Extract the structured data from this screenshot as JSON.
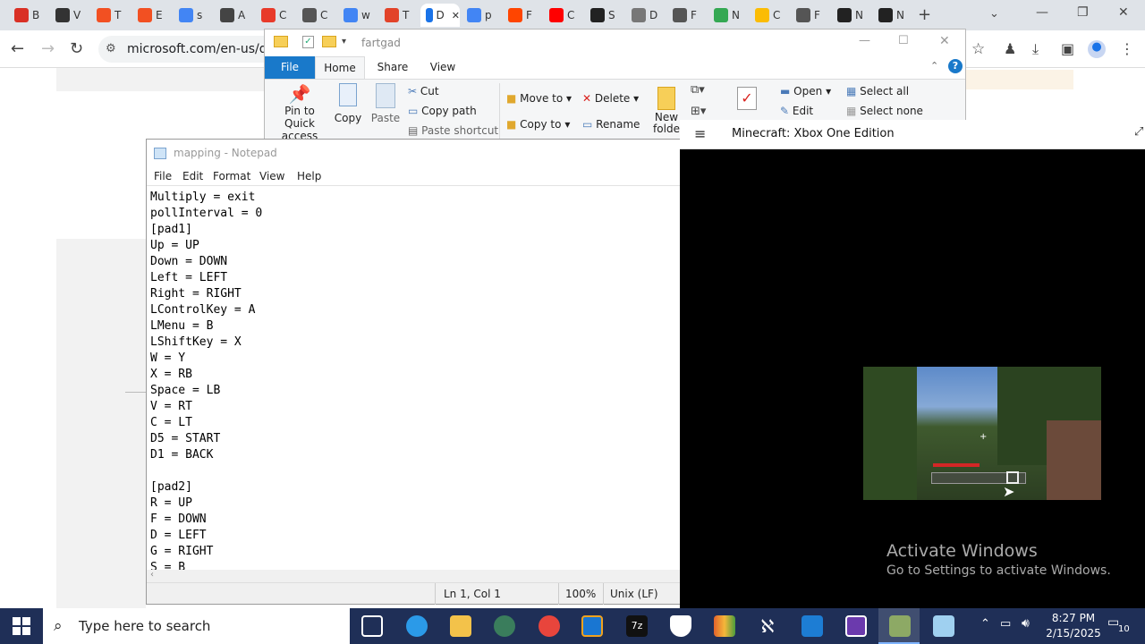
{
  "browser": {
    "tabs": [
      {
        "label": "B",
        "icon": "record-icon",
        "color": "#d93025"
      },
      {
        "label": "V",
        "icon": "book-icon",
        "color": "#333333"
      },
      {
        "label": "T",
        "icon": "windows-logo-icon",
        "color": "#f25022"
      },
      {
        "label": "E",
        "icon": "windows-logo-icon",
        "color": "#f25022"
      },
      {
        "label": "s",
        "icon": "google-icon",
        "color": "#4285f4"
      },
      {
        "label": "A",
        "icon": "tool-icon",
        "color": "#444444"
      },
      {
        "label": "C",
        "icon": "opera-icon",
        "color": "#e83a2a"
      },
      {
        "label": "C",
        "icon": "globe-icon",
        "color": "#555555"
      },
      {
        "label": "w",
        "icon": "google-icon",
        "color": "#4285f4"
      },
      {
        "label": "T",
        "icon": "gitlab-icon",
        "color": "#e24329"
      },
      {
        "label": "D",
        "icon": "page-icon",
        "color": "#1a73e8"
      },
      {
        "label": "p",
        "icon": "google-icon",
        "color": "#4285f4"
      },
      {
        "label": "F",
        "icon": "reddit-icon",
        "color": "#ff4500"
      },
      {
        "label": "C",
        "icon": "youtube-icon",
        "color": "#ff0000"
      },
      {
        "label": "S",
        "icon": "question-icon",
        "color": "#222222"
      },
      {
        "label": "D",
        "icon": "bar-icon",
        "color": "#777777"
      },
      {
        "label": "F",
        "icon": "globe-icon",
        "color": "#555555"
      },
      {
        "label": "N",
        "icon": "drive-icon",
        "color": "#34a853"
      },
      {
        "label": "C",
        "icon": "drive-icon",
        "color": "#fbbc04"
      },
      {
        "label": "F",
        "icon": "globe-icon",
        "color": "#555555"
      },
      {
        "label": "N",
        "icon": "chatgpt-icon",
        "color": "#222222"
      },
      {
        "label": "N",
        "icon": "chatgpt-icon",
        "color": "#222222"
      }
    ],
    "url": "microsoft.com/en-us/dov"
  },
  "explorer": {
    "title": "fartgad",
    "tabs": {
      "file": "File",
      "home": "Home",
      "share": "Share",
      "view": "View"
    },
    "ribbon": {
      "pin": "Pin to Quick access",
      "copy": "Copy",
      "paste": "Paste",
      "cut": "Cut",
      "copy_path": "Copy path",
      "paste_shortcut": "Paste shortcut",
      "move_to": "Move to",
      "copy_to": "Copy to",
      "delete": "Delete",
      "rename": "Rename",
      "new_folder": "New folde",
      "open": "Open",
      "edit": "Edit",
      "select_all": "Select all",
      "select_none": "Select none"
    }
  },
  "notepad": {
    "title": "mapping - Notepad",
    "menu": [
      "File",
      "Edit",
      "Format",
      "View",
      "Help"
    ],
    "lines": [
      "Multiply = exit",
      "pollInterval = 0",
      "[pad1]",
      "Up = UP",
      "Down = DOWN",
      "Left = LEFT",
      "Right = RIGHT",
      "LControlKey = A",
      "LMenu = B",
      "LShiftKey = X",
      "W = Y",
      "X = RB",
      "Space = LB",
      "V = RT",
      "C = LT",
      "D5 = START",
      "D1 = BACK",
      "",
      "[pad2]",
      "R = UP",
      "F = DOWN",
      "D = LEFT",
      "G = RIGHT",
      "S = B"
    ],
    "status": {
      "position": "Ln 1, Col 1",
      "zoom": "100%",
      "eol": "Unix (LF)"
    }
  },
  "minecraft": {
    "title": "Minecraft: Xbox One Edition"
  },
  "activation": {
    "title": "Activate Windows",
    "subtitle": "Go to Settings to activate Windows."
  },
  "taskbar": {
    "search_placeholder": "Type here to search",
    "time": "8:27 PM",
    "date": "2/15/2025",
    "notifications": "10"
  }
}
